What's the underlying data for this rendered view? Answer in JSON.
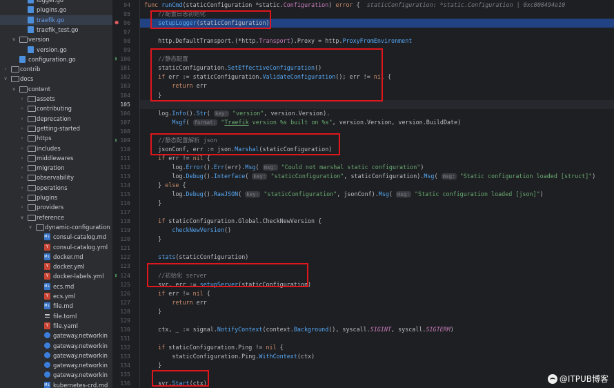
{
  "file_tree": [
    {
      "label": "logger.go",
      "depth": 3,
      "icon": "go-file-icon",
      "chevron": "",
      "partial": true
    },
    {
      "label": "plugins.go",
      "depth": 3,
      "icon": "go-file-icon",
      "chevron": ""
    },
    {
      "label": "traefik.go",
      "depth": 3,
      "icon": "go-file-icon",
      "chevron": "",
      "selected": true
    },
    {
      "label": "traefik_test.go",
      "depth": 3,
      "icon": "go-file-icon",
      "chevron": ""
    },
    {
      "label": "version",
      "depth": 2,
      "icon": "folder-icon",
      "chevron": "down"
    },
    {
      "label": "version.go",
      "depth": 3,
      "icon": "go-file-icon",
      "chevron": ""
    },
    {
      "label": "configuration.go",
      "depth": 2,
      "icon": "go-file-icon",
      "chevron": ""
    },
    {
      "label": "contrib",
      "depth": 1,
      "icon": "folder-icon",
      "chevron": "right"
    },
    {
      "label": "docs",
      "depth": 1,
      "icon": "folder-icon",
      "chevron": "down"
    },
    {
      "label": "content",
      "depth": 2,
      "icon": "folder-icon",
      "chevron": "down"
    },
    {
      "label": "assets",
      "depth": 3,
      "icon": "folder-icon",
      "chevron": "right"
    },
    {
      "label": "contributing",
      "depth": 3,
      "icon": "folder-icon",
      "chevron": "right"
    },
    {
      "label": "deprecation",
      "depth": 3,
      "icon": "folder-icon",
      "chevron": "right"
    },
    {
      "label": "getting-started",
      "depth": 3,
      "icon": "folder-icon",
      "chevron": "right"
    },
    {
      "label": "https",
      "depth": 3,
      "icon": "folder-icon",
      "chevron": "right"
    },
    {
      "label": "includes",
      "depth": 3,
      "icon": "folder-icon",
      "chevron": "right"
    },
    {
      "label": "middlewares",
      "depth": 3,
      "icon": "folder-icon",
      "chevron": "right"
    },
    {
      "label": "migration",
      "depth": 3,
      "icon": "folder-icon",
      "chevron": "right"
    },
    {
      "label": "observability",
      "depth": 3,
      "icon": "folder-icon",
      "chevron": "right"
    },
    {
      "label": "operations",
      "depth": 3,
      "icon": "folder-icon",
      "chevron": "right"
    },
    {
      "label": "plugins",
      "depth": 3,
      "icon": "folder-icon",
      "chevron": "right"
    },
    {
      "label": "providers",
      "depth": 3,
      "icon": "folder-icon",
      "chevron": "right"
    },
    {
      "label": "reference",
      "depth": 3,
      "icon": "folder-icon",
      "chevron": "down"
    },
    {
      "label": "dynamic-configuration",
      "depth": 4,
      "icon": "folder-icon",
      "chevron": "down"
    },
    {
      "label": "consul-catalog.md",
      "depth": 5,
      "icon": "markdown-file-icon",
      "chevron": ""
    },
    {
      "label": "consul-catalog.yml",
      "depth": 5,
      "icon": "yaml-file-icon",
      "chevron": ""
    },
    {
      "label": "docker.md",
      "depth": 5,
      "icon": "markdown-file-icon",
      "chevron": ""
    },
    {
      "label": "docker.yml",
      "depth": 5,
      "icon": "yaml-file-icon",
      "chevron": ""
    },
    {
      "label": "docker-labels.yml",
      "depth": 5,
      "icon": "yaml-file-icon",
      "chevron": ""
    },
    {
      "label": "ecs.md",
      "depth": 5,
      "icon": "markdown-file-icon",
      "chevron": ""
    },
    {
      "label": "ecs.yml",
      "depth": 5,
      "icon": "yaml-file-icon",
      "chevron": ""
    },
    {
      "label": "file.md",
      "depth": 5,
      "icon": "markdown-file-icon",
      "chevron": ""
    },
    {
      "label": "file.toml",
      "depth": 5,
      "icon": "text-file-icon",
      "chevron": ""
    },
    {
      "label": "file.yaml",
      "depth": 5,
      "icon": "yaml-file-icon",
      "chevron": ""
    },
    {
      "label": "gateway.networkin",
      "depth": 5,
      "icon": "kubernetes-file-icon",
      "chevron": ""
    },
    {
      "label": "gateway.networkin",
      "depth": 5,
      "icon": "kubernetes-file-icon",
      "chevron": ""
    },
    {
      "label": "gateway.networkin",
      "depth": 5,
      "icon": "kubernetes-file-icon",
      "chevron": ""
    },
    {
      "label": "gateway.networkin",
      "depth": 5,
      "icon": "kubernetes-file-icon",
      "chevron": ""
    },
    {
      "label": "gateway.networkin",
      "depth": 5,
      "icon": "kubernetes-file-icon",
      "chevron": ""
    },
    {
      "label": "kubernetes-crd.md",
      "depth": 5,
      "icon": "markdown-file-icon",
      "chevron": ""
    }
  ],
  "code_lines": [
    {
      "n": "94",
      "tokens": [
        [
          "kw",
          "func "
        ],
        [
          "fn",
          "runCmd"
        ],
        [
          "plain",
          "(staticConfiguration *static."
        ],
        [
          "ty",
          "Configuration"
        ],
        [
          "plain",
          ") "
        ],
        [
          "kw",
          "error"
        ],
        [
          "plain",
          " {  "
        ],
        [
          "ital",
          "staticConfiguration: *static.Configuration | 0xc000494e10"
        ]
      ]
    },
    {
      "n": "95",
      "tokens": [
        [
          "cmt",
          "    //配置日志初始化"
        ]
      ]
    },
    {
      "n": "96",
      "hl": true,
      "tokens": [
        [
          "plain",
          "    "
        ],
        [
          "fn",
          "setupLogger"
        ],
        [
          "plain",
          "(staticConfiguration)"
        ]
      ]
    },
    {
      "n": "97",
      "tokens": []
    },
    {
      "n": "98",
      "tokens": [
        [
          "plain",
          "    http.DefaultTransport.(*http."
        ],
        [
          "ty",
          "Transport"
        ],
        [
          "plain",
          ").Proxy = http."
        ],
        [
          "fn",
          "ProxyFromEnvironment"
        ]
      ]
    },
    {
      "n": "99",
      "tokens": []
    },
    {
      "n": "100",
      "tokens": [
        [
          "cmt",
          "    //静态配置"
        ]
      ]
    },
    {
      "n": "101",
      "tokens": [
        [
          "plain",
          "    staticConfiguration."
        ],
        [
          "fn",
          "SetEffectiveConfiguration"
        ],
        [
          "plain",
          "()"
        ]
      ]
    },
    {
      "n": "102",
      "tokens": [
        [
          "kw",
          "    if "
        ],
        [
          "plain",
          "err := staticConfiguration."
        ],
        [
          "fn",
          "ValidateConfiguration"
        ],
        [
          "plain",
          "(); err != "
        ],
        [
          "kw",
          "nil"
        ],
        [
          "plain",
          " {"
        ]
      ]
    },
    {
      "n": "103",
      "tokens": [
        [
          "kw",
          "        return "
        ],
        [
          "plain",
          "err"
        ]
      ]
    },
    {
      "n": "104",
      "tokens": [
        [
          "plain",
          "    }"
        ]
      ]
    },
    {
      "n": "105",
      "caret": true,
      "tokens": []
    },
    {
      "n": "106",
      "tokens": [
        [
          "plain",
          "    log."
        ],
        [
          "fn",
          "Info"
        ],
        [
          "plain",
          "()."
        ],
        [
          "fn",
          "Str"
        ],
        [
          "plain",
          "( "
        ],
        [
          "hint",
          "key:"
        ],
        [
          "str",
          " \"version\""
        ],
        [
          "plain",
          ", version.Version)."
        ]
      ]
    },
    {
      "n": "107",
      "tokens": [
        [
          "plain",
          "        "
        ],
        [
          "fn",
          "Msgf"
        ],
        [
          "plain",
          "( "
        ],
        [
          "hint",
          "format:"
        ],
        [
          "str",
          " \""
        ],
        [
          "under",
          "Traefik"
        ],
        [
          "str",
          " version %s built on %s\""
        ],
        [
          "plain",
          ", version.Version, version.BuildDate)"
        ]
      ]
    },
    {
      "n": "108",
      "tokens": []
    },
    {
      "n": "109",
      "tokens": [
        [
          "cmt",
          "    //静态配置解析 json"
        ]
      ]
    },
    {
      "n": "110",
      "tokens": [
        [
          "plain",
          "    jsonConf, err := json."
        ],
        [
          "fn",
          "Marshal"
        ],
        [
          "plain",
          "(staticConfiguration)"
        ]
      ]
    },
    {
      "n": "111",
      "tokens": [
        [
          "kw",
          "    if "
        ],
        [
          "plain",
          "err != "
        ],
        [
          "kw",
          "nil"
        ],
        [
          "plain",
          " {"
        ]
      ]
    },
    {
      "n": "112",
      "tokens": [
        [
          "plain",
          "        log."
        ],
        [
          "fn",
          "Error"
        ],
        [
          "plain",
          "()."
        ],
        [
          "fn",
          "Err"
        ],
        [
          "plain",
          "(err)."
        ],
        [
          "fn",
          "Msg"
        ],
        [
          "plain",
          "( "
        ],
        [
          "hint",
          "msg:"
        ],
        [
          "str",
          " \"Could not marshal static configuration\""
        ],
        [
          "plain",
          ")"
        ]
      ]
    },
    {
      "n": "113",
      "tokens": [
        [
          "plain",
          "        log."
        ],
        [
          "fn",
          "Debug"
        ],
        [
          "plain",
          "()."
        ],
        [
          "fn",
          "Interface"
        ],
        [
          "plain",
          "( "
        ],
        [
          "hint",
          "key:"
        ],
        [
          "str",
          " \"staticConfiguration\""
        ],
        [
          "plain",
          ", staticConfiguration)."
        ],
        [
          "fn",
          "Msg"
        ],
        [
          "plain",
          "( "
        ],
        [
          "hint",
          "msg:"
        ],
        [
          "str",
          " \"Static configuration loaded [struct]\""
        ],
        [
          "plain",
          ")"
        ]
      ]
    },
    {
      "n": "114",
      "tokens": [
        [
          "plain",
          "    } "
        ],
        [
          "kw",
          "else"
        ],
        [
          "plain",
          " {"
        ]
      ]
    },
    {
      "n": "115",
      "tokens": [
        [
          "plain",
          "        log."
        ],
        [
          "fn",
          "Debug"
        ],
        [
          "plain",
          "()."
        ],
        [
          "fn",
          "RawJSON"
        ],
        [
          "plain",
          "( "
        ],
        [
          "hint",
          "key:"
        ],
        [
          "str",
          " \"staticConfiguration\""
        ],
        [
          "plain",
          ", jsonConf)."
        ],
        [
          "fn",
          "Msg"
        ],
        [
          "plain",
          "( "
        ],
        [
          "hint",
          "msg:"
        ],
        [
          "str",
          " \"Static configuration loaded [json]\""
        ],
        [
          "plain",
          ")"
        ]
      ]
    },
    {
      "n": "116",
      "tokens": [
        [
          "plain",
          "    }"
        ]
      ]
    },
    {
      "n": "117",
      "tokens": []
    },
    {
      "n": "118",
      "tokens": [
        [
          "kw",
          "    if "
        ],
        [
          "plain",
          "staticConfiguration.Global.CheckNewVersion {"
        ]
      ]
    },
    {
      "n": "119",
      "tokens": [
        [
          "plain",
          "        "
        ],
        [
          "fn",
          "checkNewVersion"
        ],
        [
          "plain",
          "()"
        ]
      ]
    },
    {
      "n": "120",
      "tokens": [
        [
          "plain",
          "    }"
        ]
      ]
    },
    {
      "n": "121",
      "tokens": []
    },
    {
      "n": "122",
      "tokens": [
        [
          "plain",
          "    "
        ],
        [
          "fn",
          "stats"
        ],
        [
          "plain",
          "(staticConfiguration)"
        ]
      ]
    },
    {
      "n": "123",
      "tokens": []
    },
    {
      "n": "124",
      "tokens": [
        [
          "cmt",
          "    //初始化 server"
        ]
      ]
    },
    {
      "n": "125",
      "tokens": [
        [
          "plain",
          "    svr, err := "
        ],
        [
          "fn",
          "setupServer"
        ],
        [
          "plain",
          "(staticConfiguration)"
        ]
      ]
    },
    {
      "n": "126",
      "tokens": [
        [
          "kw",
          "    if "
        ],
        [
          "plain",
          "err != "
        ],
        [
          "kw",
          "nil"
        ],
        [
          "plain",
          " {"
        ]
      ]
    },
    {
      "n": "127",
      "tokens": [
        [
          "kw",
          "        return "
        ],
        [
          "plain",
          "err"
        ]
      ]
    },
    {
      "n": "128",
      "tokens": [
        [
          "plain",
          "    }"
        ]
      ]
    },
    {
      "n": "129",
      "tokens": []
    },
    {
      "n": "130",
      "tokens": [
        [
          "plain",
          "    ctx, _ := signal."
        ],
        [
          "fn",
          "NotifyContext"
        ],
        [
          "plain",
          "(context."
        ],
        [
          "fn",
          "Background"
        ],
        [
          "plain",
          "(), syscall."
        ],
        [
          "italconst",
          "SIGINT"
        ],
        [
          "plain",
          ", syscall."
        ],
        [
          "italconst",
          "SIGTERM"
        ],
        [
          "plain",
          ")"
        ]
      ]
    },
    {
      "n": "131",
      "tokens": []
    },
    {
      "n": "132",
      "tokens": [
        [
          "kw",
          "    if "
        ],
        [
          "plain",
          "staticConfiguration.Ping != "
        ],
        [
          "kw",
          "nil"
        ],
        [
          "plain",
          " {"
        ]
      ]
    },
    {
      "n": "133",
      "tokens": [
        [
          "plain",
          "        staticConfiguration.Ping."
        ],
        [
          "fn",
          "WithContext"
        ],
        [
          "plain",
          "(ctx)"
        ]
      ]
    },
    {
      "n": "134",
      "tokens": [
        [
          "plain",
          "    }"
        ]
      ]
    },
    {
      "n": "135",
      "tokens": []
    },
    {
      "n": "136",
      "tokens": [
        [
          "plain",
          "    svr."
        ],
        [
          "fn",
          "Start"
        ],
        [
          "plain",
          "(ctx)"
        ]
      ]
    }
  ],
  "watermark": {
    "text": "@ITPUB博客"
  },
  "colors": {
    "annotation_red": "#e0161d",
    "selection_blue": "#214283",
    "keyword": "#cf8e6d",
    "function": "#56a8f5",
    "string": "#6aab73",
    "comment": "#7a7e85"
  }
}
